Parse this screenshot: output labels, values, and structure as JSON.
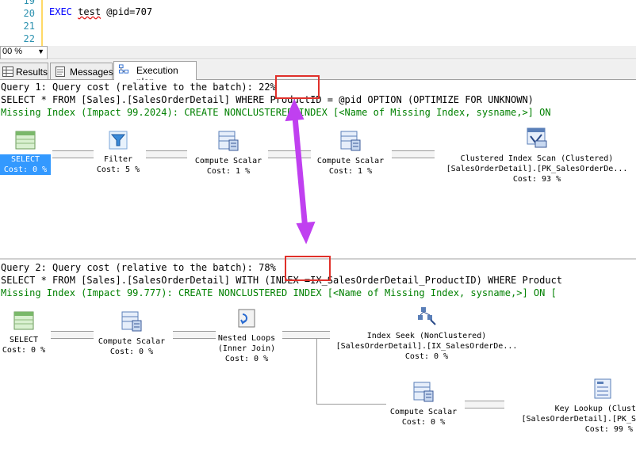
{
  "editor": {
    "line_numbers": [
      "19",
      "20",
      "21",
      "22"
    ],
    "code_keyword": "EXEC",
    "code_proc": "test",
    "code_rest": " @pid=707"
  },
  "zoom": {
    "value": "00 %"
  },
  "tabs": {
    "results": "Results",
    "messages": "Messages",
    "execution_plan": "Execution plan"
  },
  "query1": {
    "header_prefix": "Query 1: Query cost (relative to the batch)",
    "header_cost": ": 22%",
    "sql": "SELECT * FROM [Sales].[SalesOrderDetail] WHERE ProductID = @pid OPTION (OPTIMIZE FOR UNKNOWN)",
    "missing_index": "Missing Index (Impact 99.2024): CREATE NONCLUSTERED INDEX [<Name of Missing Index, sysname,>] ON",
    "operators": {
      "select": {
        "name": "SELECT",
        "cost": "Cost: 0 %"
      },
      "filter": {
        "name": "Filter",
        "cost": "Cost: 5 %"
      },
      "compute1": {
        "name": "Compute Scalar",
        "cost": "Cost: 1 %"
      },
      "compute2": {
        "name": "Compute Scalar",
        "cost": "Cost: 1 %"
      },
      "scan": {
        "name": "Clustered Index Scan (Clustered)",
        "object": "[SalesOrderDetail].[PK_SalesOrderDe...",
        "cost": "Cost: 93 %"
      }
    }
  },
  "query2": {
    "header_prefix": "Query 2: Query cost (relative to the batch):",
    "header_cost": " 78%",
    "sql": "SELECT * FROM [Sales].[SalesOrderDetail] WITH (INDEX =IX_SalesOrderDetail_ProductID) WHERE Product",
    "missing_index": "Missing Index (Impact 99.777): CREATE NONCLUSTERED INDEX [<Name of Missing Index, sysname,>] ON [",
    "operators": {
      "select": {
        "name": "SELECT",
        "cost": "Cost: 0 %"
      },
      "compute1": {
        "name": "Compute Scalar",
        "cost": "Cost: 0 %"
      },
      "nested": {
        "name": "Nested Loops",
        "sub": "(Inner Join)",
        "cost": "Cost: 0 %"
      },
      "seek": {
        "name": "Index Seek (NonClustered)",
        "object": "[SalesOrderDetail].[IX_SalesOrderDe...",
        "cost": "Cost: 0 %"
      },
      "compute2": {
        "name": "Compute Scalar",
        "cost": "Cost: 0 %"
      },
      "lookup": {
        "name": "Key Lookup (Clust",
        "object": "[SalesOrderDetail].[PK_S",
        "cost": "Cost: 99 %"
      }
    }
  },
  "colors": {
    "annotation_arrow": "#c040f0",
    "highlight_box": "#e0302a",
    "select_highlight": "#3399ff"
  }
}
